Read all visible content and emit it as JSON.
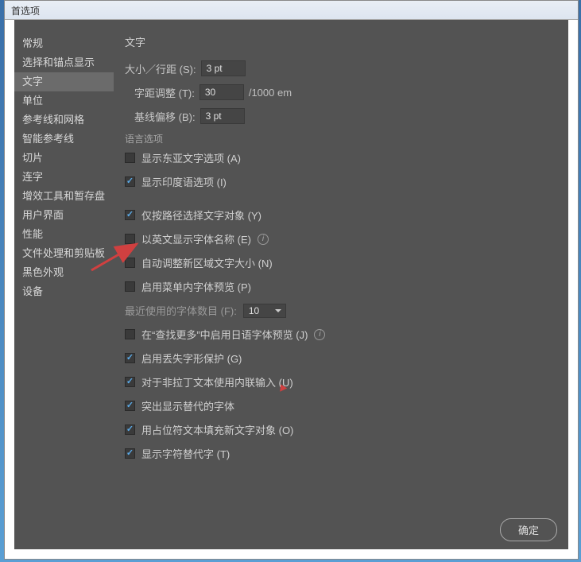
{
  "window": {
    "title": "首选项"
  },
  "sidebar": {
    "items": [
      {
        "label": "常规",
        "selected": false
      },
      {
        "label": "选择和锚点显示",
        "selected": false
      },
      {
        "label": "文字",
        "selected": true
      },
      {
        "label": "单位",
        "selected": false
      },
      {
        "label": "参考线和网格",
        "selected": false
      },
      {
        "label": "智能参考线",
        "selected": false
      },
      {
        "label": "切片",
        "selected": false
      },
      {
        "label": "连字",
        "selected": false
      },
      {
        "label": "增效工具和暂存盘",
        "selected": false
      },
      {
        "label": "用户界面",
        "selected": false
      },
      {
        "label": "性能",
        "selected": false
      },
      {
        "label": "文件处理和剪贴板",
        "selected": false
      },
      {
        "label": "黑色外观",
        "selected": false
      },
      {
        "label": "设备",
        "selected": false
      }
    ]
  },
  "main": {
    "heading": "文字",
    "size_leading": {
      "label": "大小／行距 (S):",
      "value": "3 pt"
    },
    "tracking": {
      "label": "字距调整 (T):",
      "value": "30",
      "unit": "/1000 em"
    },
    "baseline": {
      "label": "基线偏移 (B):",
      "value": "3 pt"
    },
    "lang_group": "语言选项",
    "checkboxes": {
      "east_asian": {
        "label": "显示东亚文字选项 (A)",
        "checked": false
      },
      "indic": {
        "label": "显示印度语选项 (I)",
        "checked": true
      },
      "path_only": {
        "label": "仅按路径选择文字对象 (Y)",
        "checked": true
      },
      "english_fontname": {
        "label": "以英文显示字体名称 (E)",
        "checked": false,
        "info": true
      },
      "auto_area": {
        "label": "自动调整新区域文字大小 (N)",
        "checked": false
      },
      "menu_preview": {
        "label": "启用菜单内字体预览 (P)",
        "checked": false
      },
      "recent_fonts": {
        "label": "最近使用的字体数目 (F):",
        "value": "10"
      },
      "jp_preview": {
        "label": "在“查找更多”中启用日语字体预览 (J)",
        "checked": false,
        "info": true
      },
      "missing_glyph": {
        "label": "启用丢失字形保护 (G)",
        "checked": true
      },
      "inline_input": {
        "label": "对于非拉丁文本使用内联输入 (U)",
        "checked": true
      },
      "highlight_alt": {
        "label": "突出显示替代的字体",
        "checked": true
      },
      "placeholder_fill": {
        "label": "用占位符文本填充新文字对象 (O)",
        "checked": true
      },
      "show_alt_glyph": {
        "label": "显示字符替代字 (T)",
        "checked": true
      }
    }
  },
  "footer": {
    "ok": "确定"
  }
}
